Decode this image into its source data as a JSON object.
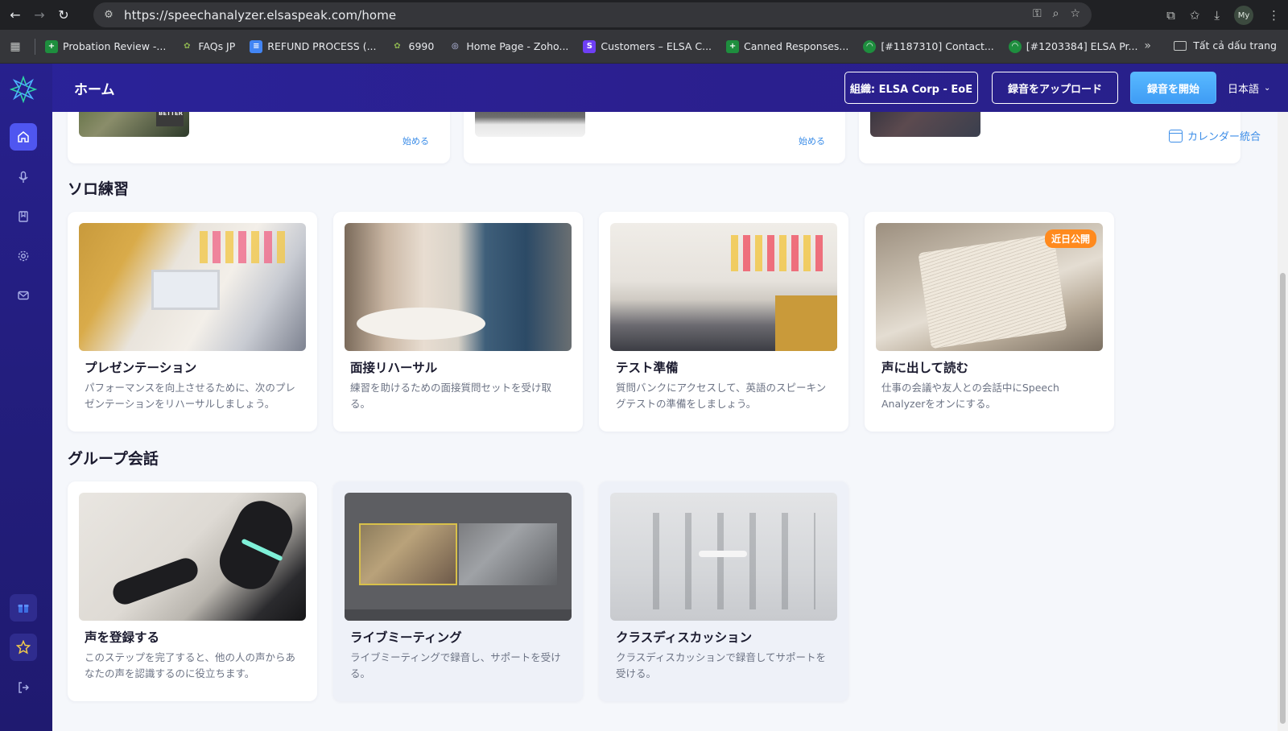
{
  "browser": {
    "url": "https://speechanalyzer.elsaspeak.com/home",
    "profile_initials": "My",
    "bookmarks": [
      {
        "label": "Probation Review -...",
        "color": "#1e8e3e"
      },
      {
        "label": "FAQs JP",
        "color": "#5f8a3a"
      },
      {
        "label": "REFUND PROCESS (...",
        "color": "#4285f4"
      },
      {
        "label": "6990",
        "color": "#5f8a3a"
      },
      {
        "label": "Home Page - Zoho...",
        "color": "#6b7bd6"
      },
      {
        "label": "Customers – ELSA C...",
        "color": "#6e3ff5"
      },
      {
        "label": "Canned Responses...",
        "color": "#1e8e3e"
      },
      {
        "label": "[#1187310] Contact...",
        "color": "#1e8e3e"
      },
      {
        "label": "[#1203384] ELSA Pr...",
        "color": "#1e8e3e"
      }
    ],
    "all_bookmarks_label": "Tất cả dấu trang"
  },
  "header": {
    "title": "ホーム",
    "org_button": "組織: ELSA Corp - EoE",
    "upload_button": "録音をアップロード",
    "record_button": "録音を開始",
    "language": "日本語"
  },
  "top_cards": {
    "start_label": "始める",
    "calendar_label": "カレンダー統合"
  },
  "sections": {
    "solo": {
      "title": "ソロ練習",
      "cards": [
        {
          "title": "プレゼンテーション",
          "desc": "パフォーマンスを向上させるために、次のプレゼンテーションをリハーサルしましょう。"
        },
        {
          "title": "面接リハーサル",
          "desc": "練習を助けるための面接質問セットを受け取る。"
        },
        {
          "title": "テスト準備",
          "desc": "質問バンクにアクセスして、英語のスピーキングテストの準備をしましょう。"
        },
        {
          "title": "声に出して読む",
          "desc": "仕事の会議や友人との会話中にSpeech Analyzerをオンにする。",
          "badge": "近日公開"
        }
      ]
    },
    "group": {
      "title": "グループ会話",
      "cards": [
        {
          "title": "声を登録する",
          "desc": "このステップを完了すると、他の人の声からあなたの声を認識するのに役立ちます。"
        },
        {
          "title": "ライブミーティング",
          "desc": "ライブミーティングで録音し、サポートを受ける。"
        },
        {
          "title": "クラスディスカッション",
          "desc": "クラスディスカッションで録音してサポートを受ける。"
        }
      ]
    }
  },
  "colors": {
    "brand": "#2a2399",
    "accent": "#3f9cf5",
    "badge": "#ff8a1e"
  }
}
